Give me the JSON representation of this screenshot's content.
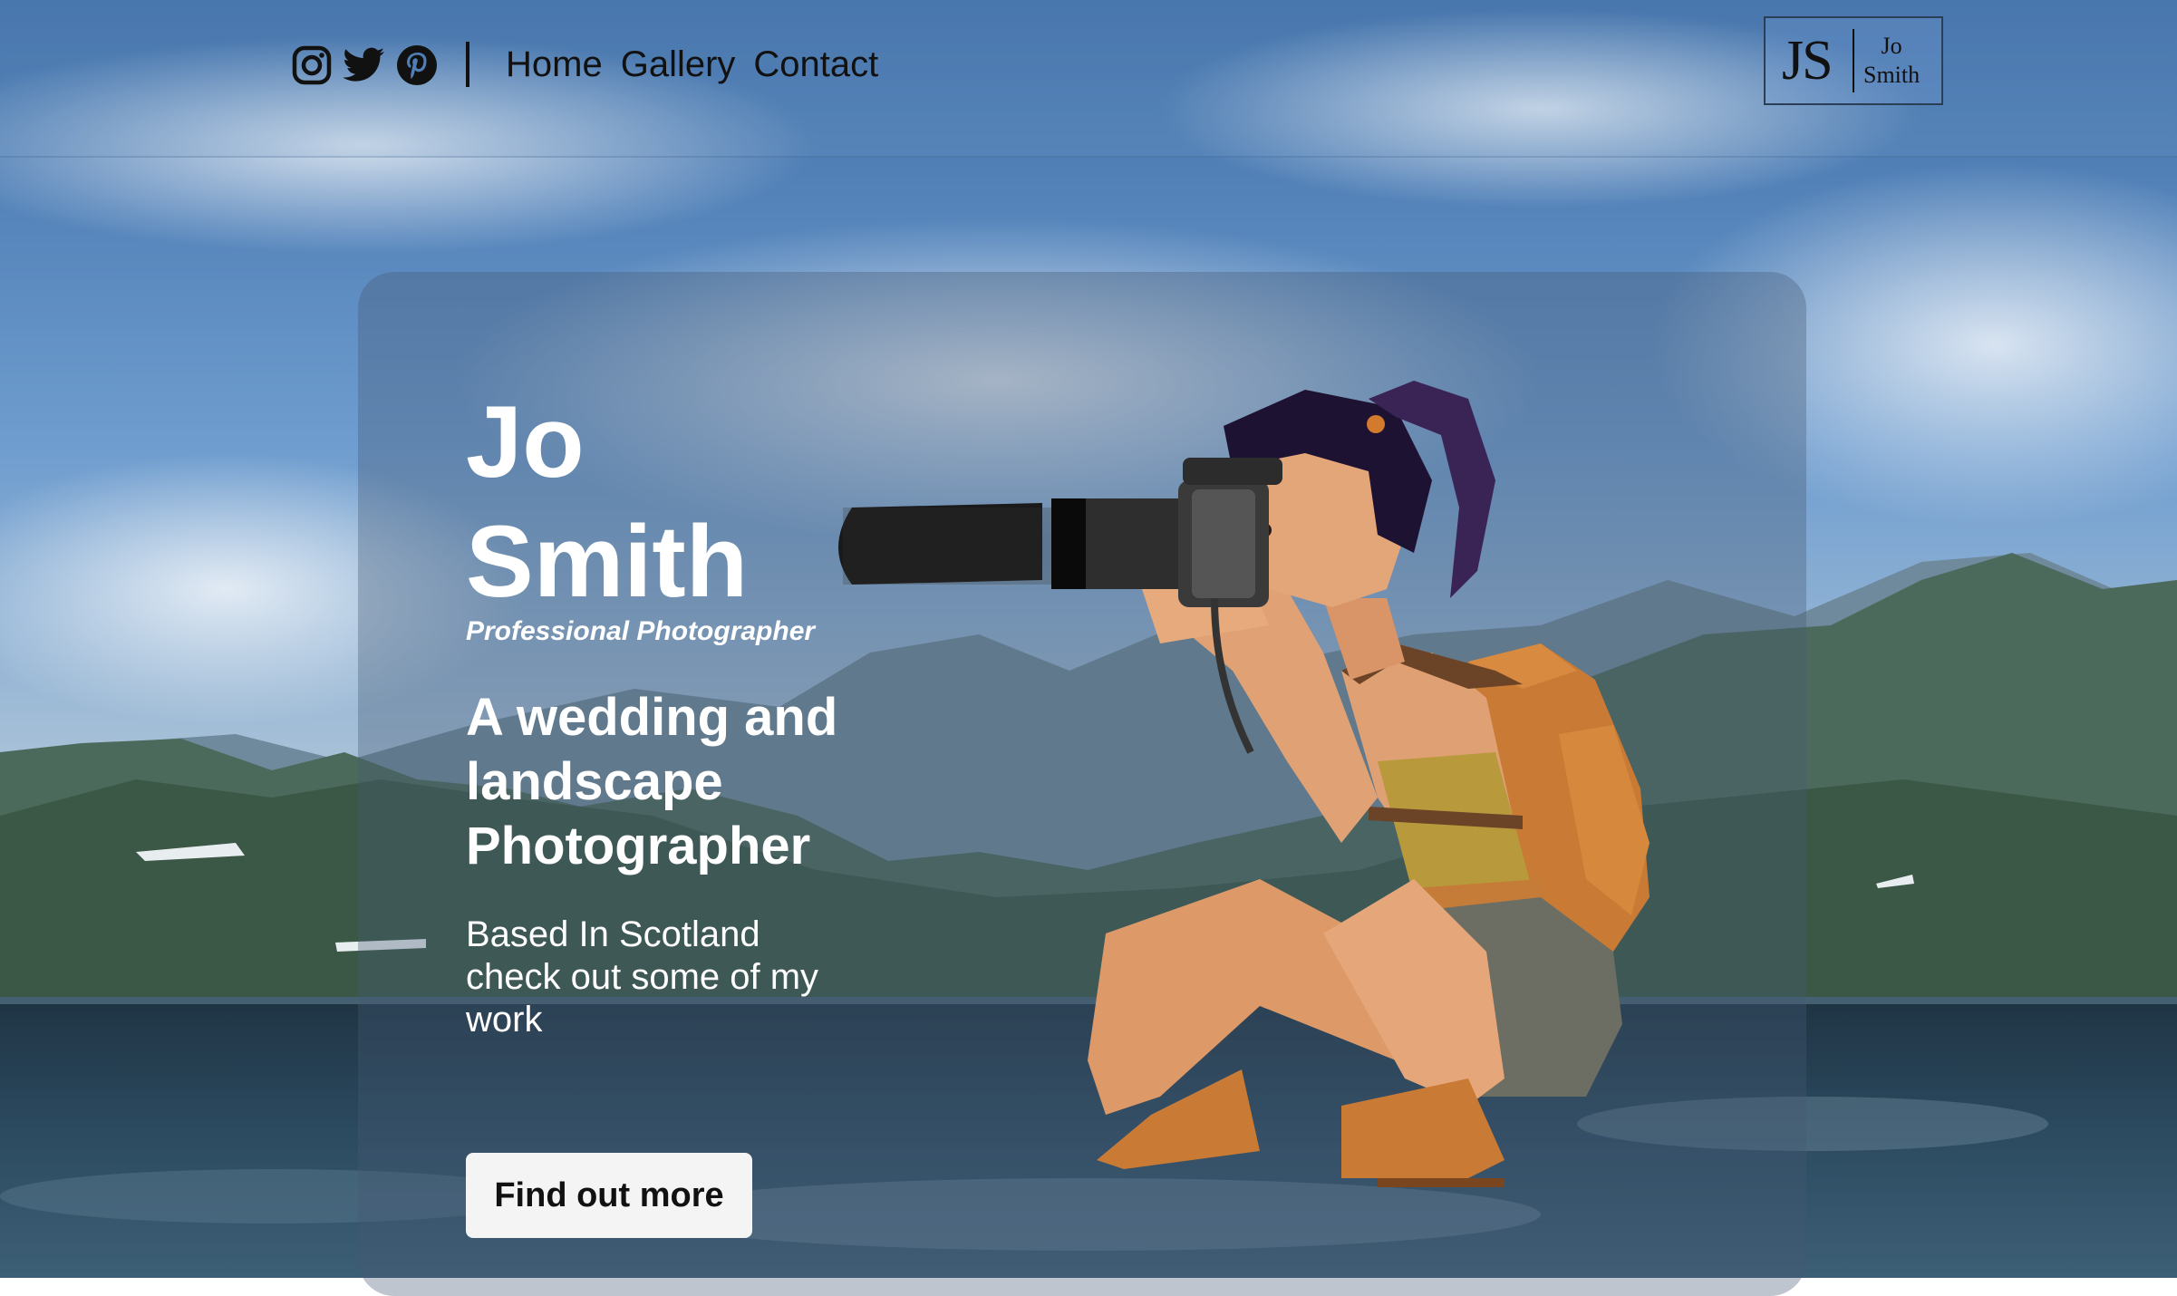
{
  "header": {
    "socials": [
      {
        "icon": "instagram-icon"
      },
      {
        "icon": "twitter-icon"
      },
      {
        "icon": "pinterest-icon"
      }
    ],
    "nav": [
      {
        "label": "Home"
      },
      {
        "label": "Gallery"
      },
      {
        "label": "Contact"
      }
    ],
    "logo": {
      "monogram": "JS",
      "first": "Jo",
      "last": "Smith"
    }
  },
  "hero": {
    "name_first": "Jo",
    "name_last": "Smith",
    "tagline": "Professional Photographer",
    "headline": "A wedding and landscape Photographer",
    "subtext": "Based In Scotland check out some of my work",
    "cta_label": "Find out more",
    "illustration": "photographer-illustration"
  },
  "colors": {
    "sky": "#4f7fb6",
    "text": "#ffffff",
    "nav_text": "#111111",
    "button_bg": "#f4f4f4"
  }
}
